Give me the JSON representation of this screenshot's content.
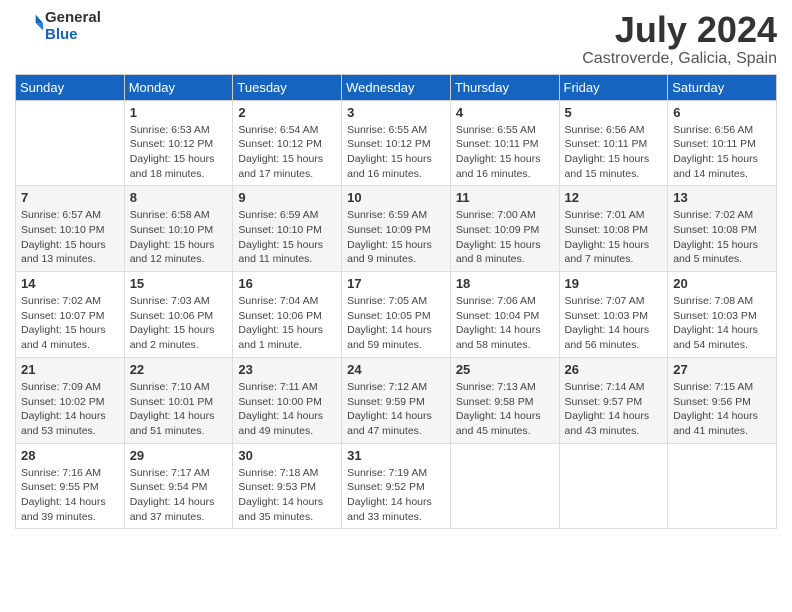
{
  "logo": {
    "line1": "General",
    "line2": "Blue"
  },
  "title": "July 2024",
  "subtitle": "Castroverde, Galicia, Spain",
  "headers": [
    "Sunday",
    "Monday",
    "Tuesday",
    "Wednesday",
    "Thursday",
    "Friday",
    "Saturday"
  ],
  "rows": [
    [
      {
        "num": "",
        "info": ""
      },
      {
        "num": "1",
        "info": "Sunrise: 6:53 AM\nSunset: 10:12 PM\nDaylight: 15 hours\nand 18 minutes."
      },
      {
        "num": "2",
        "info": "Sunrise: 6:54 AM\nSunset: 10:12 PM\nDaylight: 15 hours\nand 17 minutes."
      },
      {
        "num": "3",
        "info": "Sunrise: 6:55 AM\nSunset: 10:12 PM\nDaylight: 15 hours\nand 16 minutes."
      },
      {
        "num": "4",
        "info": "Sunrise: 6:55 AM\nSunset: 10:11 PM\nDaylight: 15 hours\nand 16 minutes."
      },
      {
        "num": "5",
        "info": "Sunrise: 6:56 AM\nSunset: 10:11 PM\nDaylight: 15 hours\nand 15 minutes."
      },
      {
        "num": "6",
        "info": "Sunrise: 6:56 AM\nSunset: 10:11 PM\nDaylight: 15 hours\nand 14 minutes."
      }
    ],
    [
      {
        "num": "7",
        "info": "Sunrise: 6:57 AM\nSunset: 10:10 PM\nDaylight: 15 hours\nand 13 minutes."
      },
      {
        "num": "8",
        "info": "Sunrise: 6:58 AM\nSunset: 10:10 PM\nDaylight: 15 hours\nand 12 minutes."
      },
      {
        "num": "9",
        "info": "Sunrise: 6:59 AM\nSunset: 10:10 PM\nDaylight: 15 hours\nand 11 minutes."
      },
      {
        "num": "10",
        "info": "Sunrise: 6:59 AM\nSunset: 10:09 PM\nDaylight: 15 hours\nand 9 minutes."
      },
      {
        "num": "11",
        "info": "Sunrise: 7:00 AM\nSunset: 10:09 PM\nDaylight: 15 hours\nand 8 minutes."
      },
      {
        "num": "12",
        "info": "Sunrise: 7:01 AM\nSunset: 10:08 PM\nDaylight: 15 hours\nand 7 minutes."
      },
      {
        "num": "13",
        "info": "Sunrise: 7:02 AM\nSunset: 10:08 PM\nDaylight: 15 hours\nand 5 minutes."
      }
    ],
    [
      {
        "num": "14",
        "info": "Sunrise: 7:02 AM\nSunset: 10:07 PM\nDaylight: 15 hours\nand 4 minutes."
      },
      {
        "num": "15",
        "info": "Sunrise: 7:03 AM\nSunset: 10:06 PM\nDaylight: 15 hours\nand 2 minutes."
      },
      {
        "num": "16",
        "info": "Sunrise: 7:04 AM\nSunset: 10:06 PM\nDaylight: 15 hours\nand 1 minute."
      },
      {
        "num": "17",
        "info": "Sunrise: 7:05 AM\nSunset: 10:05 PM\nDaylight: 14 hours\nand 59 minutes."
      },
      {
        "num": "18",
        "info": "Sunrise: 7:06 AM\nSunset: 10:04 PM\nDaylight: 14 hours\nand 58 minutes."
      },
      {
        "num": "19",
        "info": "Sunrise: 7:07 AM\nSunset: 10:03 PM\nDaylight: 14 hours\nand 56 minutes."
      },
      {
        "num": "20",
        "info": "Sunrise: 7:08 AM\nSunset: 10:03 PM\nDaylight: 14 hours\nand 54 minutes."
      }
    ],
    [
      {
        "num": "21",
        "info": "Sunrise: 7:09 AM\nSunset: 10:02 PM\nDaylight: 14 hours\nand 53 minutes."
      },
      {
        "num": "22",
        "info": "Sunrise: 7:10 AM\nSunset: 10:01 PM\nDaylight: 14 hours\nand 51 minutes."
      },
      {
        "num": "23",
        "info": "Sunrise: 7:11 AM\nSunset: 10:00 PM\nDaylight: 14 hours\nand 49 minutes."
      },
      {
        "num": "24",
        "info": "Sunrise: 7:12 AM\nSunset: 9:59 PM\nDaylight: 14 hours\nand 47 minutes."
      },
      {
        "num": "25",
        "info": "Sunrise: 7:13 AM\nSunset: 9:58 PM\nDaylight: 14 hours\nand 45 minutes."
      },
      {
        "num": "26",
        "info": "Sunrise: 7:14 AM\nSunset: 9:57 PM\nDaylight: 14 hours\nand 43 minutes."
      },
      {
        "num": "27",
        "info": "Sunrise: 7:15 AM\nSunset: 9:56 PM\nDaylight: 14 hours\nand 41 minutes."
      }
    ],
    [
      {
        "num": "28",
        "info": "Sunrise: 7:16 AM\nSunset: 9:55 PM\nDaylight: 14 hours\nand 39 minutes."
      },
      {
        "num": "29",
        "info": "Sunrise: 7:17 AM\nSunset: 9:54 PM\nDaylight: 14 hours\nand 37 minutes."
      },
      {
        "num": "30",
        "info": "Sunrise: 7:18 AM\nSunset: 9:53 PM\nDaylight: 14 hours\nand 35 minutes."
      },
      {
        "num": "31",
        "info": "Sunrise: 7:19 AM\nSunset: 9:52 PM\nDaylight: 14 hours\nand 33 minutes."
      },
      {
        "num": "",
        "info": ""
      },
      {
        "num": "",
        "info": ""
      },
      {
        "num": "",
        "info": ""
      }
    ]
  ]
}
